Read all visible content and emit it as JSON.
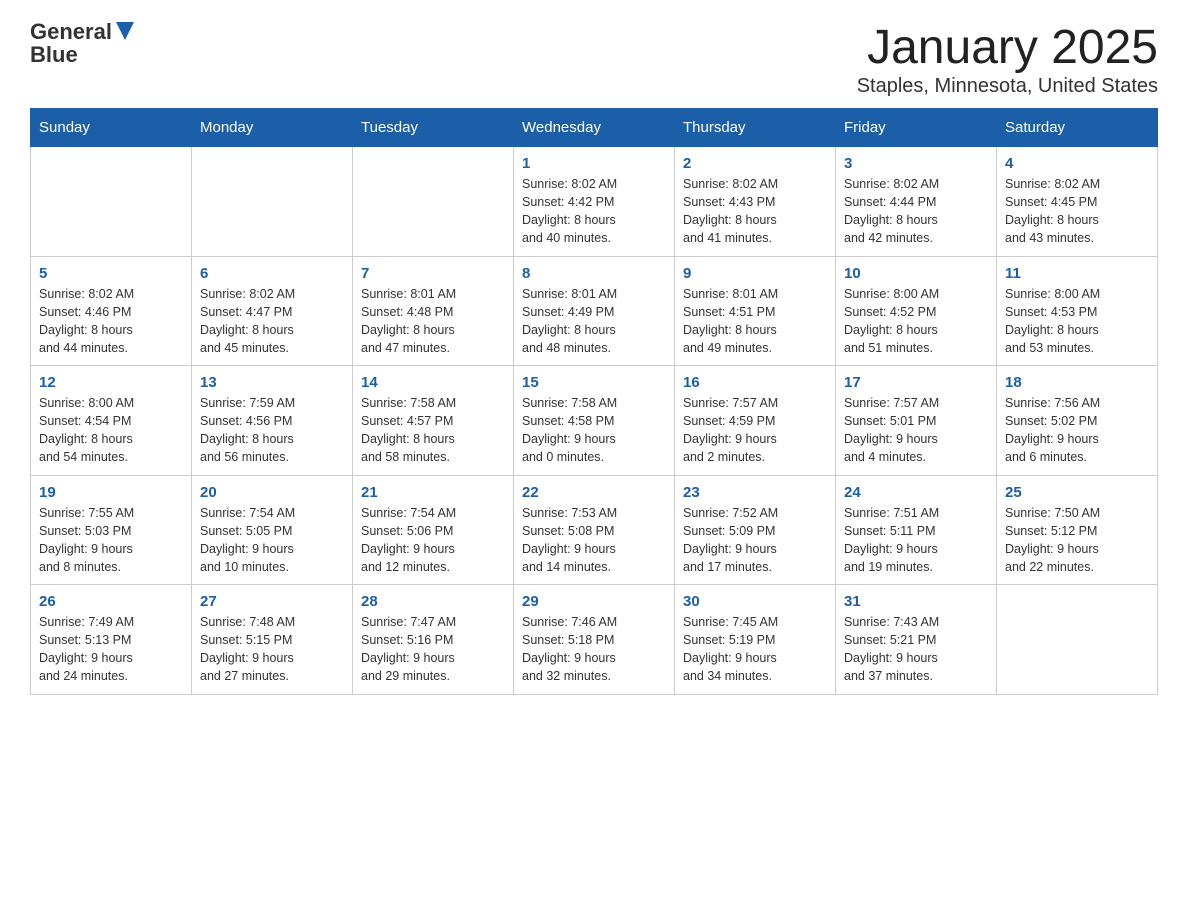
{
  "header": {
    "logo_text_general": "General",
    "logo_text_blue": "Blue",
    "title": "January 2025",
    "subtitle": "Staples, Minnesota, United States"
  },
  "days_of_week": [
    "Sunday",
    "Monday",
    "Tuesday",
    "Wednesday",
    "Thursday",
    "Friday",
    "Saturday"
  ],
  "weeks": [
    [
      {
        "day": "",
        "info": ""
      },
      {
        "day": "",
        "info": ""
      },
      {
        "day": "",
        "info": ""
      },
      {
        "day": "1",
        "info": "Sunrise: 8:02 AM\nSunset: 4:42 PM\nDaylight: 8 hours\nand 40 minutes."
      },
      {
        "day": "2",
        "info": "Sunrise: 8:02 AM\nSunset: 4:43 PM\nDaylight: 8 hours\nand 41 minutes."
      },
      {
        "day": "3",
        "info": "Sunrise: 8:02 AM\nSunset: 4:44 PM\nDaylight: 8 hours\nand 42 minutes."
      },
      {
        "day": "4",
        "info": "Sunrise: 8:02 AM\nSunset: 4:45 PM\nDaylight: 8 hours\nand 43 minutes."
      }
    ],
    [
      {
        "day": "5",
        "info": "Sunrise: 8:02 AM\nSunset: 4:46 PM\nDaylight: 8 hours\nand 44 minutes."
      },
      {
        "day": "6",
        "info": "Sunrise: 8:02 AM\nSunset: 4:47 PM\nDaylight: 8 hours\nand 45 minutes."
      },
      {
        "day": "7",
        "info": "Sunrise: 8:01 AM\nSunset: 4:48 PM\nDaylight: 8 hours\nand 47 minutes."
      },
      {
        "day": "8",
        "info": "Sunrise: 8:01 AM\nSunset: 4:49 PM\nDaylight: 8 hours\nand 48 minutes."
      },
      {
        "day": "9",
        "info": "Sunrise: 8:01 AM\nSunset: 4:51 PM\nDaylight: 8 hours\nand 49 minutes."
      },
      {
        "day": "10",
        "info": "Sunrise: 8:00 AM\nSunset: 4:52 PM\nDaylight: 8 hours\nand 51 minutes."
      },
      {
        "day": "11",
        "info": "Sunrise: 8:00 AM\nSunset: 4:53 PM\nDaylight: 8 hours\nand 53 minutes."
      }
    ],
    [
      {
        "day": "12",
        "info": "Sunrise: 8:00 AM\nSunset: 4:54 PM\nDaylight: 8 hours\nand 54 minutes."
      },
      {
        "day": "13",
        "info": "Sunrise: 7:59 AM\nSunset: 4:56 PM\nDaylight: 8 hours\nand 56 minutes."
      },
      {
        "day": "14",
        "info": "Sunrise: 7:58 AM\nSunset: 4:57 PM\nDaylight: 8 hours\nand 58 minutes."
      },
      {
        "day": "15",
        "info": "Sunrise: 7:58 AM\nSunset: 4:58 PM\nDaylight: 9 hours\nand 0 minutes."
      },
      {
        "day": "16",
        "info": "Sunrise: 7:57 AM\nSunset: 4:59 PM\nDaylight: 9 hours\nand 2 minutes."
      },
      {
        "day": "17",
        "info": "Sunrise: 7:57 AM\nSunset: 5:01 PM\nDaylight: 9 hours\nand 4 minutes."
      },
      {
        "day": "18",
        "info": "Sunrise: 7:56 AM\nSunset: 5:02 PM\nDaylight: 9 hours\nand 6 minutes."
      }
    ],
    [
      {
        "day": "19",
        "info": "Sunrise: 7:55 AM\nSunset: 5:03 PM\nDaylight: 9 hours\nand 8 minutes."
      },
      {
        "day": "20",
        "info": "Sunrise: 7:54 AM\nSunset: 5:05 PM\nDaylight: 9 hours\nand 10 minutes."
      },
      {
        "day": "21",
        "info": "Sunrise: 7:54 AM\nSunset: 5:06 PM\nDaylight: 9 hours\nand 12 minutes."
      },
      {
        "day": "22",
        "info": "Sunrise: 7:53 AM\nSunset: 5:08 PM\nDaylight: 9 hours\nand 14 minutes."
      },
      {
        "day": "23",
        "info": "Sunrise: 7:52 AM\nSunset: 5:09 PM\nDaylight: 9 hours\nand 17 minutes."
      },
      {
        "day": "24",
        "info": "Sunrise: 7:51 AM\nSunset: 5:11 PM\nDaylight: 9 hours\nand 19 minutes."
      },
      {
        "day": "25",
        "info": "Sunrise: 7:50 AM\nSunset: 5:12 PM\nDaylight: 9 hours\nand 22 minutes."
      }
    ],
    [
      {
        "day": "26",
        "info": "Sunrise: 7:49 AM\nSunset: 5:13 PM\nDaylight: 9 hours\nand 24 minutes."
      },
      {
        "day": "27",
        "info": "Sunrise: 7:48 AM\nSunset: 5:15 PM\nDaylight: 9 hours\nand 27 minutes."
      },
      {
        "day": "28",
        "info": "Sunrise: 7:47 AM\nSunset: 5:16 PM\nDaylight: 9 hours\nand 29 minutes."
      },
      {
        "day": "29",
        "info": "Sunrise: 7:46 AM\nSunset: 5:18 PM\nDaylight: 9 hours\nand 32 minutes."
      },
      {
        "day": "30",
        "info": "Sunrise: 7:45 AM\nSunset: 5:19 PM\nDaylight: 9 hours\nand 34 minutes."
      },
      {
        "day": "31",
        "info": "Sunrise: 7:43 AM\nSunset: 5:21 PM\nDaylight: 9 hours\nand 37 minutes."
      },
      {
        "day": "",
        "info": ""
      }
    ]
  ]
}
